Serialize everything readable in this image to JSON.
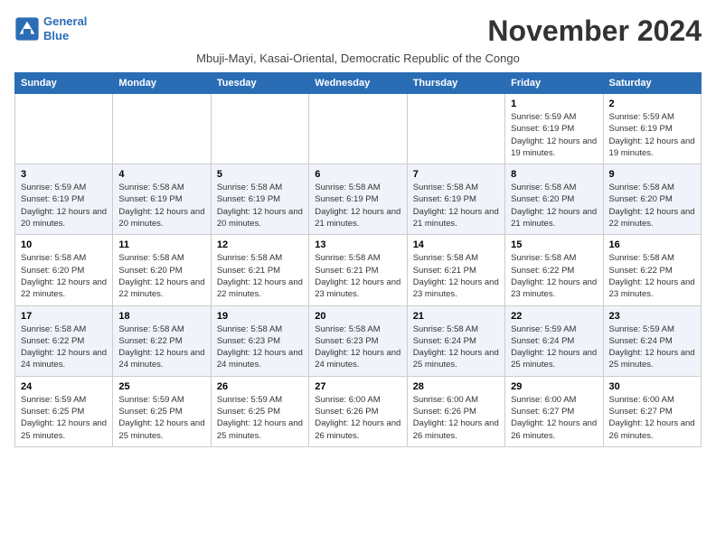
{
  "logo": {
    "line1": "General",
    "line2": "Blue"
  },
  "title": "November 2024",
  "subtitle": "Mbuji-Mayi, Kasai-Oriental, Democratic Republic of the Congo",
  "headers": [
    "Sunday",
    "Monday",
    "Tuesday",
    "Wednesday",
    "Thursday",
    "Friday",
    "Saturday"
  ],
  "weeks": [
    [
      {
        "day": "",
        "info": ""
      },
      {
        "day": "",
        "info": ""
      },
      {
        "day": "",
        "info": ""
      },
      {
        "day": "",
        "info": ""
      },
      {
        "day": "",
        "info": ""
      },
      {
        "day": "1",
        "info": "Sunrise: 5:59 AM\nSunset: 6:19 PM\nDaylight: 12 hours and 19 minutes."
      },
      {
        "day": "2",
        "info": "Sunrise: 5:59 AM\nSunset: 6:19 PM\nDaylight: 12 hours and 19 minutes."
      }
    ],
    [
      {
        "day": "3",
        "info": "Sunrise: 5:59 AM\nSunset: 6:19 PM\nDaylight: 12 hours and 20 minutes."
      },
      {
        "day": "4",
        "info": "Sunrise: 5:58 AM\nSunset: 6:19 PM\nDaylight: 12 hours and 20 minutes."
      },
      {
        "day": "5",
        "info": "Sunrise: 5:58 AM\nSunset: 6:19 PM\nDaylight: 12 hours and 20 minutes."
      },
      {
        "day": "6",
        "info": "Sunrise: 5:58 AM\nSunset: 6:19 PM\nDaylight: 12 hours and 21 minutes."
      },
      {
        "day": "7",
        "info": "Sunrise: 5:58 AM\nSunset: 6:19 PM\nDaylight: 12 hours and 21 minutes."
      },
      {
        "day": "8",
        "info": "Sunrise: 5:58 AM\nSunset: 6:20 PM\nDaylight: 12 hours and 21 minutes."
      },
      {
        "day": "9",
        "info": "Sunrise: 5:58 AM\nSunset: 6:20 PM\nDaylight: 12 hours and 22 minutes."
      }
    ],
    [
      {
        "day": "10",
        "info": "Sunrise: 5:58 AM\nSunset: 6:20 PM\nDaylight: 12 hours and 22 minutes."
      },
      {
        "day": "11",
        "info": "Sunrise: 5:58 AM\nSunset: 6:20 PM\nDaylight: 12 hours and 22 minutes."
      },
      {
        "day": "12",
        "info": "Sunrise: 5:58 AM\nSunset: 6:21 PM\nDaylight: 12 hours and 22 minutes."
      },
      {
        "day": "13",
        "info": "Sunrise: 5:58 AM\nSunset: 6:21 PM\nDaylight: 12 hours and 23 minutes."
      },
      {
        "day": "14",
        "info": "Sunrise: 5:58 AM\nSunset: 6:21 PM\nDaylight: 12 hours and 23 minutes."
      },
      {
        "day": "15",
        "info": "Sunrise: 5:58 AM\nSunset: 6:22 PM\nDaylight: 12 hours and 23 minutes."
      },
      {
        "day": "16",
        "info": "Sunrise: 5:58 AM\nSunset: 6:22 PM\nDaylight: 12 hours and 23 minutes."
      }
    ],
    [
      {
        "day": "17",
        "info": "Sunrise: 5:58 AM\nSunset: 6:22 PM\nDaylight: 12 hours and 24 minutes."
      },
      {
        "day": "18",
        "info": "Sunrise: 5:58 AM\nSunset: 6:22 PM\nDaylight: 12 hours and 24 minutes."
      },
      {
        "day": "19",
        "info": "Sunrise: 5:58 AM\nSunset: 6:23 PM\nDaylight: 12 hours and 24 minutes."
      },
      {
        "day": "20",
        "info": "Sunrise: 5:58 AM\nSunset: 6:23 PM\nDaylight: 12 hours and 24 minutes."
      },
      {
        "day": "21",
        "info": "Sunrise: 5:58 AM\nSunset: 6:24 PM\nDaylight: 12 hours and 25 minutes."
      },
      {
        "day": "22",
        "info": "Sunrise: 5:59 AM\nSunset: 6:24 PM\nDaylight: 12 hours and 25 minutes."
      },
      {
        "day": "23",
        "info": "Sunrise: 5:59 AM\nSunset: 6:24 PM\nDaylight: 12 hours and 25 minutes."
      }
    ],
    [
      {
        "day": "24",
        "info": "Sunrise: 5:59 AM\nSunset: 6:25 PM\nDaylight: 12 hours and 25 minutes."
      },
      {
        "day": "25",
        "info": "Sunrise: 5:59 AM\nSunset: 6:25 PM\nDaylight: 12 hours and 25 minutes."
      },
      {
        "day": "26",
        "info": "Sunrise: 5:59 AM\nSunset: 6:25 PM\nDaylight: 12 hours and 25 minutes."
      },
      {
        "day": "27",
        "info": "Sunrise: 6:00 AM\nSunset: 6:26 PM\nDaylight: 12 hours and 26 minutes."
      },
      {
        "day": "28",
        "info": "Sunrise: 6:00 AM\nSunset: 6:26 PM\nDaylight: 12 hours and 26 minutes."
      },
      {
        "day": "29",
        "info": "Sunrise: 6:00 AM\nSunset: 6:27 PM\nDaylight: 12 hours and 26 minutes."
      },
      {
        "day": "30",
        "info": "Sunrise: 6:00 AM\nSunset: 6:27 PM\nDaylight: 12 hours and 26 minutes."
      }
    ]
  ]
}
